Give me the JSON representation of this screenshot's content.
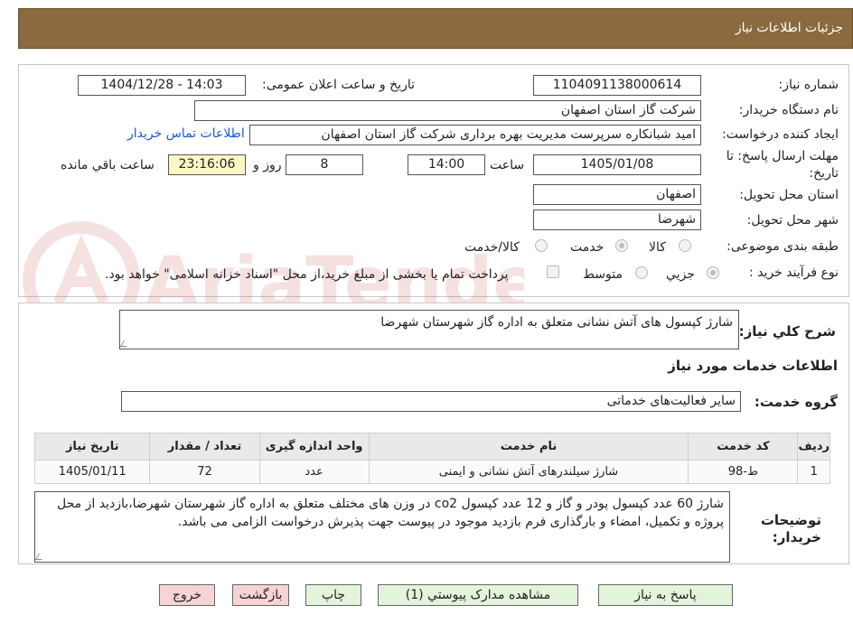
{
  "header": {
    "title": "جزئیات اطلاعات نیاز"
  },
  "fields": {
    "need_number_label": "شماره نیاز:",
    "need_number": "1104091138000614",
    "announce_label": "تاریخ و ساعت اعلان عمومی:",
    "announce_value": "1404/12/28 - 14:03",
    "buyer_label": "نام دستگاه خریدار:",
    "buyer_value": "شرکت گاز استان اصفهان",
    "requester_label": "ایجاد کننده درخواست:",
    "requester_value": "امید شبانکاره سرپرست  مدیریت بهره برداری  شرکت گاز استان اصفهان",
    "contact_link": "اطلاعات تماس خریدار",
    "deadline_label_1": "مهلت ارسال پاسخ: تا",
    "deadline_label_2": "تاریخ:",
    "deadline_date": "1405/01/08",
    "time_label": "ساعت",
    "deadline_time": "14:00",
    "days_value": "8",
    "days_label": "روز و",
    "remaining_time": "23:16:06",
    "remaining_label": "ساعت باقي مانده",
    "province_label": "استان محل تحویل:",
    "province_value": "اصفهان",
    "city_label": "شهر محل تحویل:",
    "city_value": "شهرضا",
    "category_label": "طبقه بندی موضوعی:",
    "category_options": [
      "کالا",
      "خدمت",
      "کالا/خدمت"
    ],
    "category_selected": "خدمت",
    "process_label": "نوع فرآیند خرید :",
    "process_options": [
      "جزیي",
      "متوسط"
    ],
    "process_selected": "جزیي",
    "payment_note": "پرداخت تمام یا بخشی از مبلغ خرید،از محل \"اسناد خزانه اسلامی\" خواهد بود."
  },
  "description": {
    "label": "شرح کلي نیاز:",
    "value": "شارژ کپسول های آتش نشانی متعلق به اداره گاز شهرستان شهرضا"
  },
  "services": {
    "section_title": "اطلاعات خدمات مورد نیاز",
    "group_label": "گروه خدمت:",
    "group_value": "سایر فعالیت‌های خدماتی",
    "columns": [
      "ردیف",
      "کد خدمت",
      "نام خدمت",
      "واحد اندازه گیری",
      "تعداد / مقدار",
      "تاریخ نیاز"
    ],
    "rows": [
      {
        "row": "1",
        "code": "ط-98",
        "name": "شارژ سیلندرهای آتش نشانی و ایمنی",
        "unit": "عدد",
        "qty": "72",
        "date": "1405/01/11"
      }
    ]
  },
  "buyer_notes": {
    "label_1": "توضیحات",
    "label_2": "خریدار:",
    "value": "شارژ 60 عدد کپسول پودر و گاز و 12 عدد کپسول co2 در وزن های مختلف متعلق به اداره گاز شهرستان شهرضا،بازدید از محل پروژه و تکمیل، امضاء و بارگذاری فرم بازدید موجود در پیوست جهت پذیرش درخواست الزامی می باشد."
  },
  "buttons": {
    "reply": "پاسخ به نیاز",
    "attachments": "مشاهده مدارک پیوستي (1)",
    "print": "چاپ",
    "back": "بازگشت",
    "exit": "خروج"
  },
  "watermark": {
    "text": "AriaTender.neT"
  },
  "colors": {
    "header": "#8b6a3f",
    "link": "#1a5dc9",
    "green_button": "#e2f4da",
    "pink_button": "#f8d3d3",
    "highlight": "#fbf7c5"
  }
}
